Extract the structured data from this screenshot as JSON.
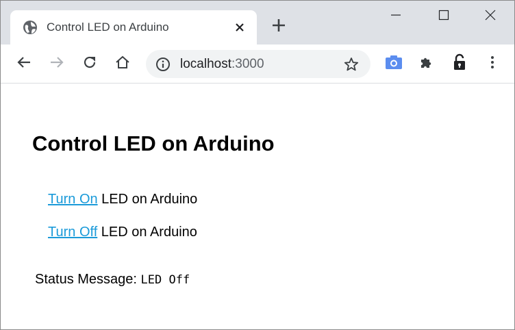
{
  "browser": {
    "tab": {
      "title": "Control LED on Arduino",
      "favicon": "globe-icon"
    },
    "new_tab_icon": "plus-icon",
    "window_controls": [
      "minimize-icon",
      "maximize-icon",
      "close-icon"
    ],
    "url_host": "localhost",
    "url_port": ":3000",
    "toolbar_icons": [
      "back-icon",
      "forward-icon",
      "reload-icon",
      "home-icon",
      "info-icon",
      "star-icon",
      "camera-icon",
      "puzzle-icon",
      "lock-icon",
      "kebab-menu-icon"
    ]
  },
  "page": {
    "title": "Control LED on Arduino",
    "controls": [
      {
        "link": "Turn On",
        "text": " LED on Arduino"
      },
      {
        "link": "Turn Off",
        "text": " LED on Arduino"
      }
    ],
    "status_label": "Status Message: ",
    "status_value": "LED Off"
  },
  "colors": {
    "link": "#1a9ad9",
    "tabstrip": "#dee1e6",
    "omnibox": "#f1f3f4",
    "camera_icon": "#5b8def"
  }
}
